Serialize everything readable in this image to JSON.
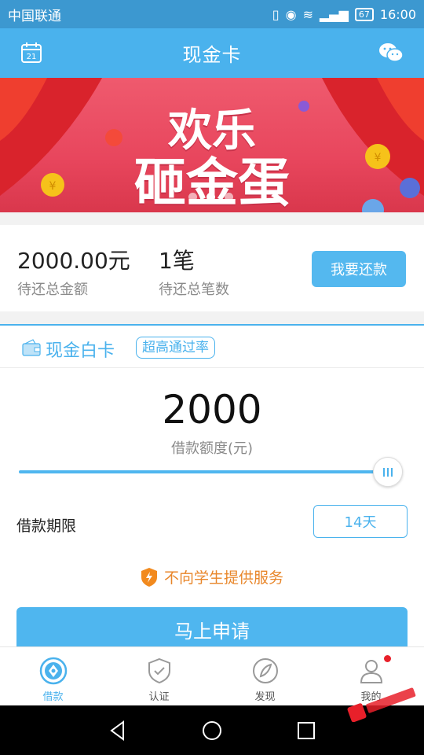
{
  "status_bar": {
    "carrier": "中国联通",
    "battery": "67",
    "time": "16:00"
  },
  "header": {
    "title": "现金卡",
    "calendar_day": "21",
    "left_icon": "calendar-icon",
    "right_icon": "wechat-icon"
  },
  "banner": {
    "line1": "欢乐",
    "line2": "砸金蛋",
    "active_slide": 2,
    "slide_count": 3
  },
  "summary": {
    "amount_value": "2000.00元",
    "amount_label": "待还总金额",
    "count_value": "1笔",
    "count_label": "待还总笔数",
    "repay_button": "我要还款"
  },
  "card": {
    "title": "现金白卡",
    "tag": "超高通过率",
    "amount": "2000",
    "amount_label": "借款额度(元)",
    "slider_level": 1.0,
    "term_label": "借款期限",
    "term_value": "14天",
    "notice": "不向学生提供服务",
    "apply_button": "马上申请"
  },
  "bottom_nav": {
    "items": [
      {
        "label": "借款",
        "icon": "loan-icon",
        "active": true
      },
      {
        "label": "认证",
        "icon": "shield-check-icon",
        "active": false
      },
      {
        "label": "发现",
        "icon": "discover-icon",
        "active": false
      },
      {
        "label": "我的",
        "icon": "user-icon",
        "active": false
      }
    ]
  },
  "colors": {
    "primary": "#4ab2ed",
    "notice": "#e8862a",
    "banner": "#e8465d"
  }
}
